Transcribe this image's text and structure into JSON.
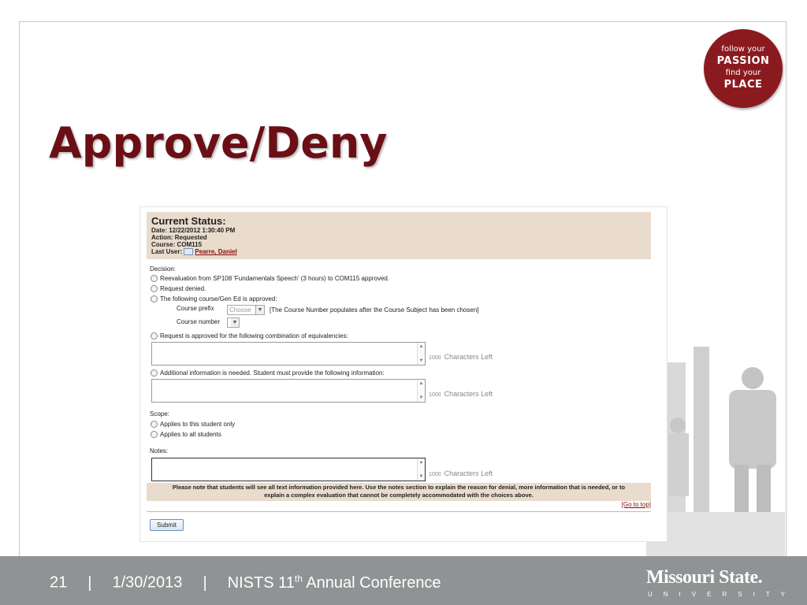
{
  "slide": {
    "title": "Approve/Deny",
    "badge": {
      "line1": "follow your",
      "line2": "PASSION",
      "line3": "find your",
      "line4": "PLACE"
    }
  },
  "form": {
    "status": {
      "heading": "Current Status:",
      "date": "Date: 12/22/2012 1:30:40 PM",
      "action": "Action: Requested",
      "course": "Course: COM115",
      "last_user_label": "Last User:",
      "last_user_name": "Pearre, Daniel"
    },
    "decision_label": "Decision:",
    "options": {
      "reevaluation": "Reevaluation from SP108 'Fundamentals Speech' (3 hours) to COM115 approved.",
      "denied": "Request denied.",
      "course_gened": "The following course/Gen Ed is approved:",
      "course_prefix_label": "Course prefix",
      "course_prefix_value": "Choose",
      "course_number_hint": "[The Course Number populates after the Course Subject has been chosen]",
      "course_number_label": "Course number",
      "combination": "Request is approved for the following combination of equivalencies:",
      "additional": "Additional information is needed. Student must provide the following information:"
    },
    "chars_count": "1000",
    "chars_label": "Characters Left",
    "scope_label": "Scope:",
    "scope_options": {
      "this_student": "Applies to this student only",
      "all_students": "Applies to all students"
    },
    "notes_label": "Notes:",
    "notice_line1": "Please note that students will see all text information provided here. Use the notes section to explain the reason for denial, more information that is needed, or to",
    "notice_line2": "explain a complex evaluation that cannot be completely accommodated with the choices above.",
    "go_to_top": "[Go to top]",
    "submit_label": "Submit"
  },
  "footer": {
    "slide_number": "21",
    "date": "1/30/2013",
    "conference_pre": "NISTS 11",
    "conference_sup": "th",
    "conference_post": " Annual Conference",
    "logo_main": "Missouri State.",
    "logo_sub": "UNIVERSITY"
  }
}
